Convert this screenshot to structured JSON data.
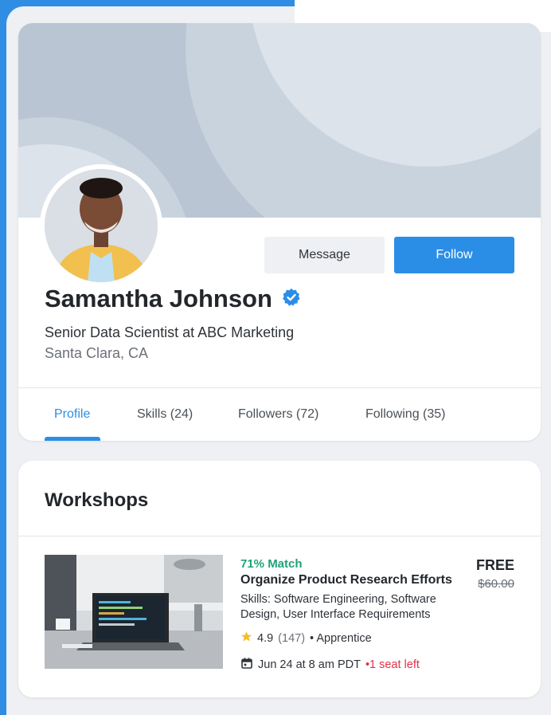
{
  "profile": {
    "name": "Samantha Johnson",
    "title": "Senior Data Scientist at ABC Marketing",
    "location": "Santa Clara, CA",
    "verified_icon": "verified-check-icon",
    "buttons": {
      "message": "Message",
      "follow": "Follow"
    }
  },
  "tabs": [
    {
      "label": "Profile",
      "active": true
    },
    {
      "label": "Skills (24)"
    },
    {
      "label": "Followers (72)"
    },
    {
      "label": "Following (35)"
    }
  ],
  "workshops": {
    "heading": "Workshops",
    "items": [
      {
        "match": "71% Match",
        "title": "Organize Product Research Efforts",
        "skills": "Skills: Software Engineering, Software Design, User Interface Requirements",
        "rating": "4.9",
        "reviews": "(147)",
        "level": "• Apprentice",
        "date": "Jun 24 at 8 am PDT",
        "seats": "•1 seat left",
        "price": "FREE",
        "old_price": "$60.00"
      }
    ]
  },
  "colors": {
    "accent": "#2b8ee6",
    "match": "#1fa27a",
    "alert": "#e0314b"
  }
}
